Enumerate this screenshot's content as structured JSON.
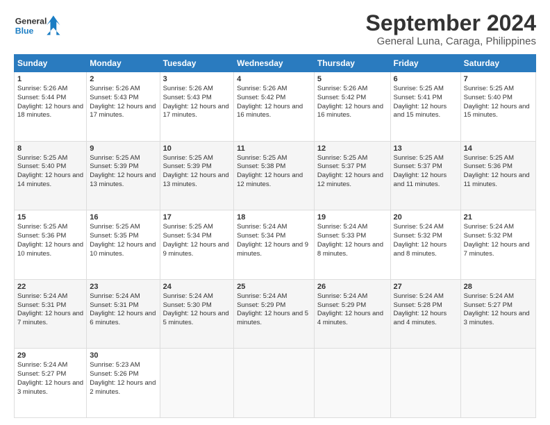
{
  "header": {
    "logo_line1": "General",
    "logo_line2": "Blue",
    "title": "September 2024",
    "subtitle": "General Luna, Caraga, Philippines"
  },
  "columns": [
    "Sunday",
    "Monday",
    "Tuesday",
    "Wednesday",
    "Thursday",
    "Friday",
    "Saturday"
  ],
  "rows": [
    [
      {
        "day": "1",
        "info": "Sunrise: 5:26 AM\nSunset: 5:44 PM\nDaylight: 12 hours and 18 minutes."
      },
      {
        "day": "2",
        "info": "Sunrise: 5:26 AM\nSunset: 5:43 PM\nDaylight: 12 hours and 17 minutes."
      },
      {
        "day": "3",
        "info": "Sunrise: 5:26 AM\nSunset: 5:43 PM\nDaylight: 12 hours and 17 minutes."
      },
      {
        "day": "4",
        "info": "Sunrise: 5:26 AM\nSunset: 5:42 PM\nDaylight: 12 hours and 16 minutes."
      },
      {
        "day": "5",
        "info": "Sunrise: 5:26 AM\nSunset: 5:42 PM\nDaylight: 12 hours and 16 minutes."
      },
      {
        "day": "6",
        "info": "Sunrise: 5:25 AM\nSunset: 5:41 PM\nDaylight: 12 hours and 15 minutes."
      },
      {
        "day": "7",
        "info": "Sunrise: 5:25 AM\nSunset: 5:40 PM\nDaylight: 12 hours and 15 minutes."
      }
    ],
    [
      {
        "day": "8",
        "info": "Sunrise: 5:25 AM\nSunset: 5:40 PM\nDaylight: 12 hours and 14 minutes."
      },
      {
        "day": "9",
        "info": "Sunrise: 5:25 AM\nSunset: 5:39 PM\nDaylight: 12 hours and 13 minutes."
      },
      {
        "day": "10",
        "info": "Sunrise: 5:25 AM\nSunset: 5:39 PM\nDaylight: 12 hours and 13 minutes."
      },
      {
        "day": "11",
        "info": "Sunrise: 5:25 AM\nSunset: 5:38 PM\nDaylight: 12 hours and 12 minutes."
      },
      {
        "day": "12",
        "info": "Sunrise: 5:25 AM\nSunset: 5:37 PM\nDaylight: 12 hours and 12 minutes."
      },
      {
        "day": "13",
        "info": "Sunrise: 5:25 AM\nSunset: 5:37 PM\nDaylight: 12 hours and 11 minutes."
      },
      {
        "day": "14",
        "info": "Sunrise: 5:25 AM\nSunset: 5:36 PM\nDaylight: 12 hours and 11 minutes."
      }
    ],
    [
      {
        "day": "15",
        "info": "Sunrise: 5:25 AM\nSunset: 5:36 PM\nDaylight: 12 hours and 10 minutes."
      },
      {
        "day": "16",
        "info": "Sunrise: 5:25 AM\nSunset: 5:35 PM\nDaylight: 12 hours and 10 minutes."
      },
      {
        "day": "17",
        "info": "Sunrise: 5:25 AM\nSunset: 5:34 PM\nDaylight: 12 hours and 9 minutes."
      },
      {
        "day": "18",
        "info": "Sunrise: 5:24 AM\nSunset: 5:34 PM\nDaylight: 12 hours and 9 minutes."
      },
      {
        "day": "19",
        "info": "Sunrise: 5:24 AM\nSunset: 5:33 PM\nDaylight: 12 hours and 8 minutes."
      },
      {
        "day": "20",
        "info": "Sunrise: 5:24 AM\nSunset: 5:32 PM\nDaylight: 12 hours and 8 minutes."
      },
      {
        "day": "21",
        "info": "Sunrise: 5:24 AM\nSunset: 5:32 PM\nDaylight: 12 hours and 7 minutes."
      }
    ],
    [
      {
        "day": "22",
        "info": "Sunrise: 5:24 AM\nSunset: 5:31 PM\nDaylight: 12 hours and 7 minutes."
      },
      {
        "day": "23",
        "info": "Sunrise: 5:24 AM\nSunset: 5:31 PM\nDaylight: 12 hours and 6 minutes."
      },
      {
        "day": "24",
        "info": "Sunrise: 5:24 AM\nSunset: 5:30 PM\nDaylight: 12 hours and 5 minutes."
      },
      {
        "day": "25",
        "info": "Sunrise: 5:24 AM\nSunset: 5:29 PM\nDaylight: 12 hours and 5 minutes."
      },
      {
        "day": "26",
        "info": "Sunrise: 5:24 AM\nSunset: 5:29 PM\nDaylight: 12 hours and 4 minutes."
      },
      {
        "day": "27",
        "info": "Sunrise: 5:24 AM\nSunset: 5:28 PM\nDaylight: 12 hours and 4 minutes."
      },
      {
        "day": "28",
        "info": "Sunrise: 5:24 AM\nSunset: 5:27 PM\nDaylight: 12 hours and 3 minutes."
      }
    ],
    [
      {
        "day": "29",
        "info": "Sunrise: 5:24 AM\nSunset: 5:27 PM\nDaylight: 12 hours and 3 minutes."
      },
      {
        "day": "30",
        "info": "Sunrise: 5:23 AM\nSunset: 5:26 PM\nDaylight: 12 hours and 2 minutes."
      },
      {
        "day": "",
        "info": ""
      },
      {
        "day": "",
        "info": ""
      },
      {
        "day": "",
        "info": ""
      },
      {
        "day": "",
        "info": ""
      },
      {
        "day": "",
        "info": ""
      }
    ]
  ]
}
